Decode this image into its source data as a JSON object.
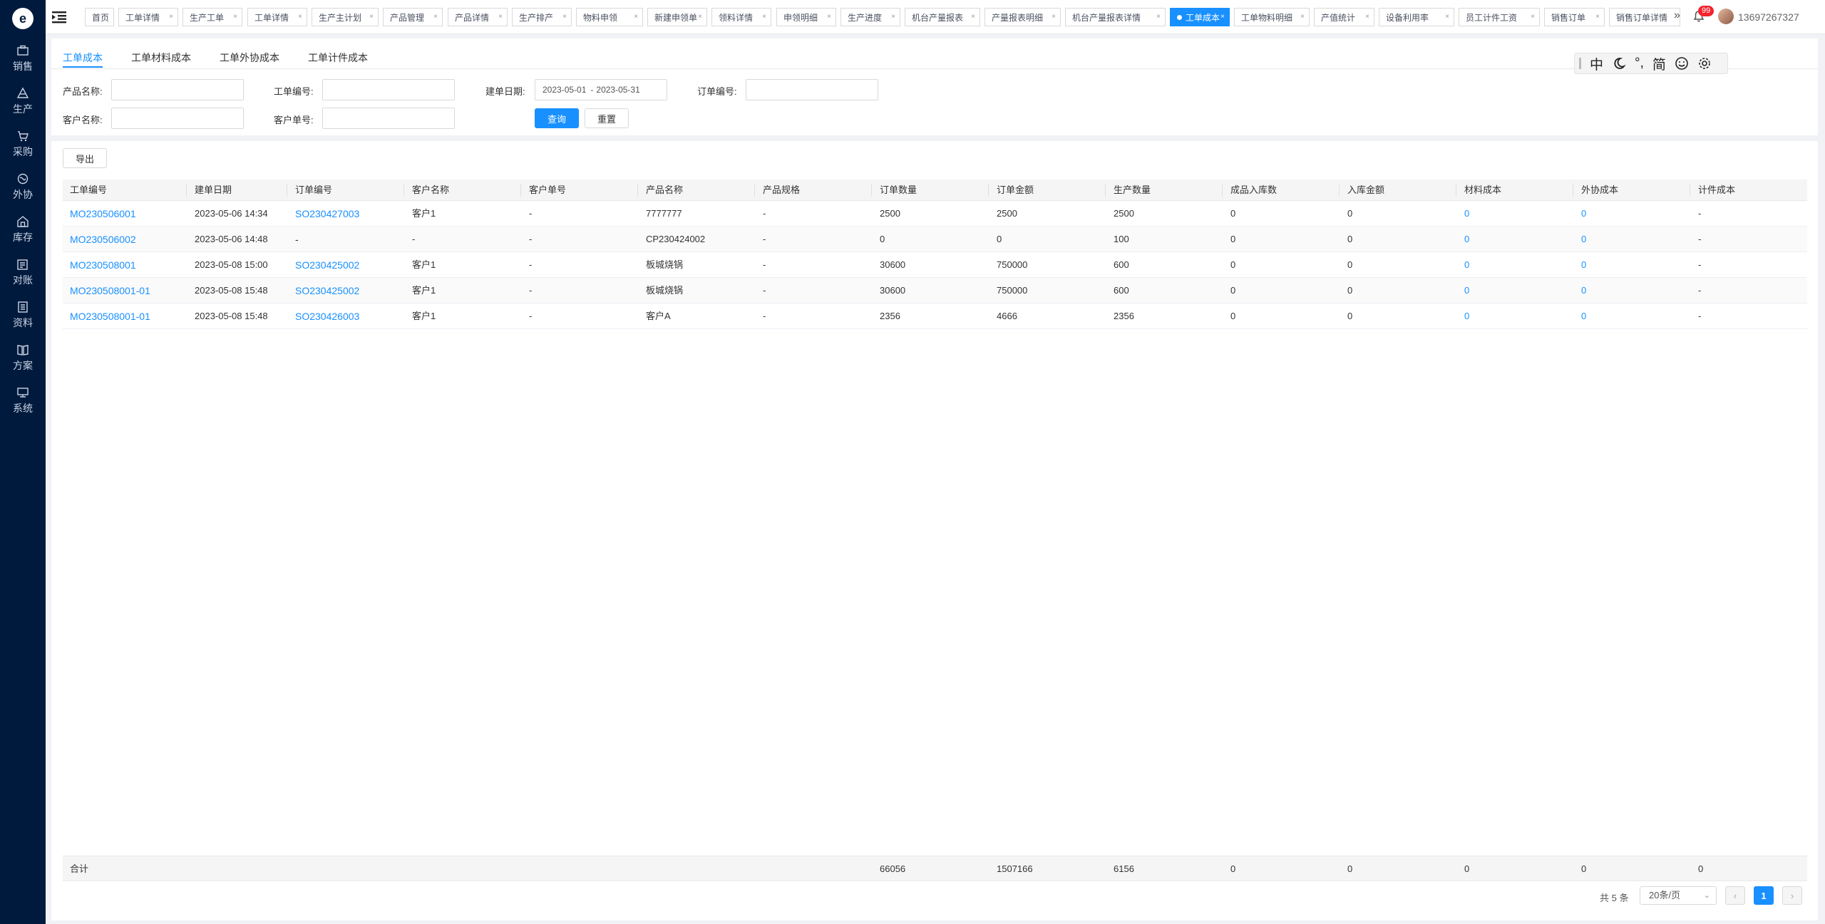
{
  "logo": "e",
  "sidebar": {
    "items": [
      {
        "label": "销售",
        "icon": "briefcase-icon"
      },
      {
        "label": "生产",
        "icon": "layers-icon"
      },
      {
        "label": "采购",
        "icon": "cart-icon"
      },
      {
        "label": "外协",
        "icon": "globe-icon"
      },
      {
        "label": "库存",
        "icon": "warehouse-icon"
      },
      {
        "label": "对账",
        "icon": "ledger-icon"
      },
      {
        "label": "资料",
        "icon": "document-icon"
      },
      {
        "label": "方案",
        "icon": "book-icon"
      },
      {
        "label": "系统",
        "icon": "monitor-icon"
      }
    ]
  },
  "header": {
    "tabs": [
      {
        "label": "首页",
        "closable": false
      },
      {
        "label": "工单详情",
        "closable": true
      },
      {
        "label": "生产工单",
        "closable": true
      },
      {
        "label": "工单详情",
        "closable": true
      },
      {
        "label": "生产主计划",
        "closable": true
      },
      {
        "label": "产品管理",
        "closable": true
      },
      {
        "label": "产品详情",
        "closable": true
      },
      {
        "label": "生产排产",
        "closable": true
      },
      {
        "label": "物料申领",
        "closable": true
      },
      {
        "label": "新建申领单",
        "closable": true
      },
      {
        "label": "领料详情",
        "closable": true
      },
      {
        "label": "申领明细",
        "closable": true
      },
      {
        "label": "生产进度",
        "closable": true
      },
      {
        "label": "机台产量报表",
        "closable": true
      },
      {
        "label": "产量报表明细",
        "closable": true
      },
      {
        "label": "机台产量报表详情",
        "closable": true
      },
      {
        "label": "工单成本",
        "closable": true,
        "active": true
      },
      {
        "label": "工单物料明细",
        "closable": true
      },
      {
        "label": "产值统计",
        "closable": true
      },
      {
        "label": "设备利用率",
        "closable": true
      },
      {
        "label": "员工计件工资",
        "closable": true
      },
      {
        "label": "销售订单",
        "closable": true
      },
      {
        "label": "销售订单详情",
        "closable": false
      }
    ],
    "more": "»",
    "badge_count": "99",
    "username": "13697267327"
  },
  "subtabs": [
    "工单成本",
    "工单材料成本",
    "工单外协成本",
    "工单计件成本"
  ],
  "ime_toolbar": {
    "chars": [
      "中",
      "°,",
      "简"
    ]
  },
  "filters": {
    "product_name_label": "产品名称:",
    "order_no_label": "工单编号:",
    "create_date_label": "建单日期:",
    "date_start": "2023-05-01",
    "date_sep": "-",
    "date_end": "2023-05-31",
    "sales_order_label": "订单编号:",
    "customer_name_label": "客户名称:",
    "customer_no_label": "客户单号:",
    "query_button": "查询",
    "reset_button": "重置"
  },
  "toolbar": {
    "export_button": "导出"
  },
  "table": {
    "columns": [
      "工单编号",
      "建单日期",
      "订单编号",
      "客户名称",
      "客户单号",
      "产品名称",
      "产品规格",
      "订单数量",
      "订单金额",
      "生产数量",
      "成品入库数",
      "入库金额",
      "材料成本",
      "外协成本",
      "计件成本"
    ],
    "rows": [
      [
        "MO230506001",
        "2023-05-06 14:34",
        "SO230427003",
        "客户1",
        "-",
        "7777777",
        "-",
        "2500",
        "2500",
        "2500",
        "0",
        "0",
        "0",
        "0",
        "-"
      ],
      [
        "MO230506002",
        "2023-05-06 14:48",
        "-",
        "-",
        "-",
        "CP230424002",
        "-",
        "0",
        "0",
        "100",
        "0",
        "0",
        "0",
        "0",
        "-"
      ],
      [
        "MO230508001",
        "2023-05-08 15:00",
        "SO230425002",
        "客户1",
        "-",
        "板城烧锅",
        "-",
        "30600",
        "750000",
        "600",
        "0",
        "0",
        "0",
        "0",
        "-"
      ],
      [
        "MO230508001-01",
        "2023-05-08 15:48",
        "SO230425002",
        "客户1",
        "-",
        "板城烧锅",
        "-",
        "30600",
        "750000",
        "600",
        "0",
        "0",
        "0",
        "0",
        "-"
      ],
      [
        "MO230508001-01",
        "2023-05-08 15:48",
        "SO230426003",
        "客户1",
        "-",
        "客户A",
        "-",
        "2356",
        "4666",
        "2356",
        "0",
        "0",
        "0",
        "0",
        "-"
      ]
    ],
    "summary_label": "合计",
    "summary": [
      "66056",
      "1507166",
      "6156",
      "0",
      "0",
      "0",
      "0",
      "0"
    ]
  },
  "pagination": {
    "total_text": "共 5 条",
    "page_size": "20条/页",
    "prev": "‹",
    "current": "1",
    "next": "›"
  }
}
